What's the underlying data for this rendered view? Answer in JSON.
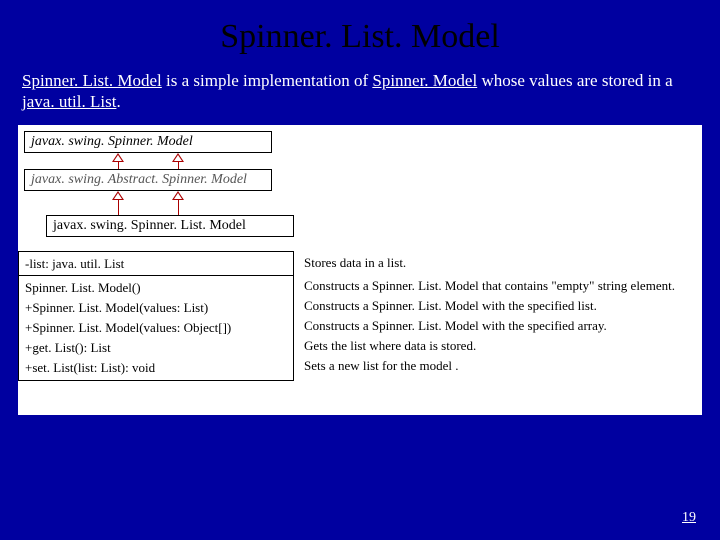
{
  "title": "Spinner. List. Model",
  "intro": {
    "link1": "Spinner. List. Model",
    "t1": " is a simple implementation of ",
    "link2": "Spinner. Model",
    "t2": " whose values are stored in a ",
    "link3": "java. util. List",
    "t3": "."
  },
  "uml": {
    "iface": "javax. swing. Spinner. Model",
    "abstract": "javax. swing. Abstract. Spinner. Model",
    "concrete": "javax. swing. Spinner. List. Model",
    "field": "-list: java. util. List",
    "methods": [
      "  Spinner. List. Model()",
      "+Spinner. List. Model(values: List)",
      "+Spinner. List. Model(values: Object[])",
      "+get. List(): List",
      "+set. List(list: List): void"
    ]
  },
  "descriptions": [
    "Stores data in a list.",
    "Constructs a Spinner. List. Model that contains \"empty\" string element.",
    "Constructs a Spinner. List. Model with the specified list.",
    "Constructs a Spinner. List. Model with the specified array.",
    "Gets the list where data is stored.",
    "Sets a new list for the model ."
  ],
  "page": "19"
}
